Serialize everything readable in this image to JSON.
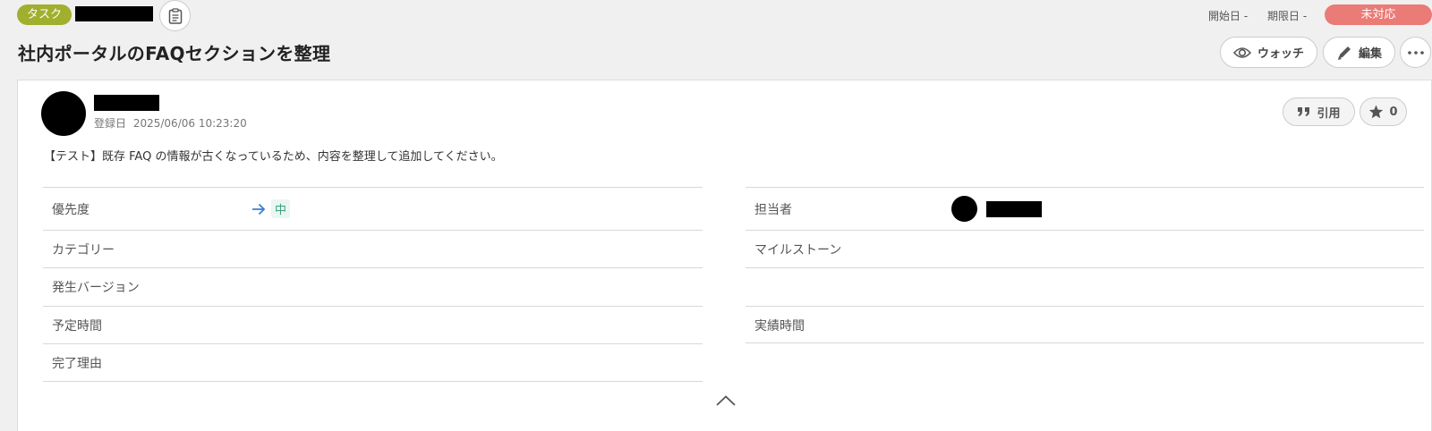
{
  "header": {
    "issue_type": "タスク",
    "start_date_label": "開始日",
    "start_date_value": "-",
    "due_date_label": "期限日",
    "due_date_value": "-",
    "status": "未対応",
    "title": "社内ポータルのFAQセクションを整理"
  },
  "actions": {
    "watch_label": "ウォッチ",
    "edit_label": "編集"
  },
  "issue": {
    "registered_label": "登録日",
    "registered_value": "2025/06/06 10:23:20",
    "description": "【テスト】既存 FAQ の情報が古くなっているため、内容を整理して追加してください。",
    "quote_label": "引用",
    "star_count": "0"
  },
  "properties": {
    "left": [
      {
        "label": "優先度",
        "value": "中"
      },
      {
        "label": "カテゴリー",
        "value": ""
      },
      {
        "label": "発生バージョン",
        "value": ""
      },
      {
        "label": "予定時間",
        "value": ""
      },
      {
        "label": "完了理由",
        "value": ""
      }
    ],
    "right": [
      {
        "label": "担当者",
        "value": ""
      },
      {
        "label": "マイルストーン",
        "value": ""
      },
      {
        "label": "",
        "value": ""
      },
      {
        "label": "実績時間",
        "value": ""
      }
    ]
  },
  "colors": {
    "issue_type_bg": "#a1af2f",
    "status_bg": "#ea7b76",
    "priority_arrow": "#3b7dd8",
    "priority_text": "#3aa17a"
  },
  "icons": {
    "clipboard": "clipboard-icon",
    "watch": "eye-icon",
    "edit": "pencil-icon",
    "more": "more-dots-icon",
    "quote": "quote-icon",
    "star": "star-icon",
    "priority": "arrow-right-icon",
    "collapse": "chevron-up-icon"
  }
}
